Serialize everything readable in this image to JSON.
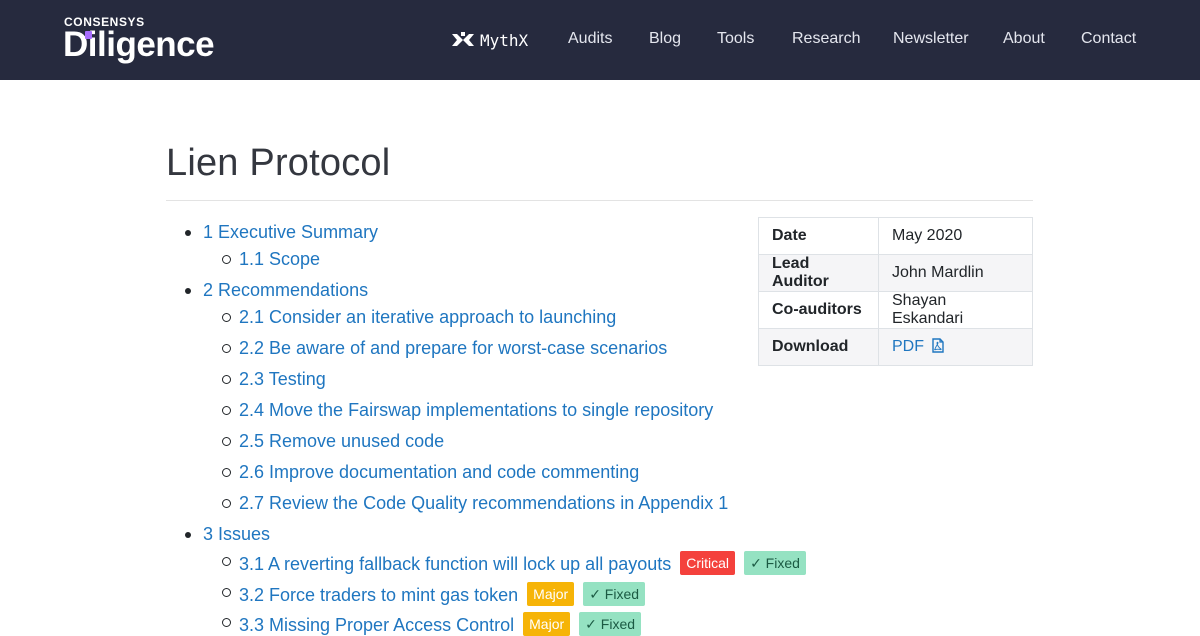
{
  "brand": {
    "top": "CONSENSYS",
    "name": "Diligence"
  },
  "nav": {
    "mythx_label": "MythX",
    "links": [
      "Audits",
      "Blog",
      "Tools",
      "Research",
      "Newsletter",
      "About",
      "Contact"
    ]
  },
  "page": {
    "title": "Lien Protocol"
  },
  "toc": [
    {
      "label": "1 Executive Summary",
      "children": [
        {
          "label": "1.1 Scope"
        }
      ]
    },
    {
      "label": "2 Recommendations",
      "children": [
        {
          "label": "2.1 Consider an iterative approach to launching"
        },
        {
          "label": "2.2 Be aware of and prepare for worst-case scenarios"
        },
        {
          "label": "2.3 Testing"
        },
        {
          "label": "2.4 Move the Fairswap implementations to single repository"
        },
        {
          "label": "2.5 Remove unused code"
        },
        {
          "label": "2.6 Improve documentation and code commenting"
        },
        {
          "label": "2.7 Review the Code Quality recommendations in Appendix 1"
        }
      ]
    },
    {
      "label": "3 Issues",
      "children": [
        {
          "label": "3.1 A reverting fallback function will lock up all payouts",
          "severity": "Critical",
          "status": "✓ Fixed"
        },
        {
          "label": "3.2 Force traders to mint gas token",
          "severity": "Major",
          "status": "✓ Fixed"
        },
        {
          "label": "3.3 Missing Proper Access Control",
          "severity": "Major",
          "status": "✓ Fixed"
        }
      ]
    }
  ],
  "meta": {
    "rows": [
      {
        "key": "Date",
        "value": "May 2020"
      },
      {
        "key": "Lead Auditor",
        "value": "John Mardlin"
      },
      {
        "key": "Co-auditors",
        "value": "Shayan Eskandari"
      },
      {
        "key": "Download",
        "value": "PDF"
      }
    ]
  },
  "colors": {
    "navbar": "#262a3e",
    "link": "#1f76c0",
    "critical": "#f4413c",
    "major": "#f6b407",
    "fixed": "#95e2c2",
    "brand_accent": "#a86dff"
  }
}
